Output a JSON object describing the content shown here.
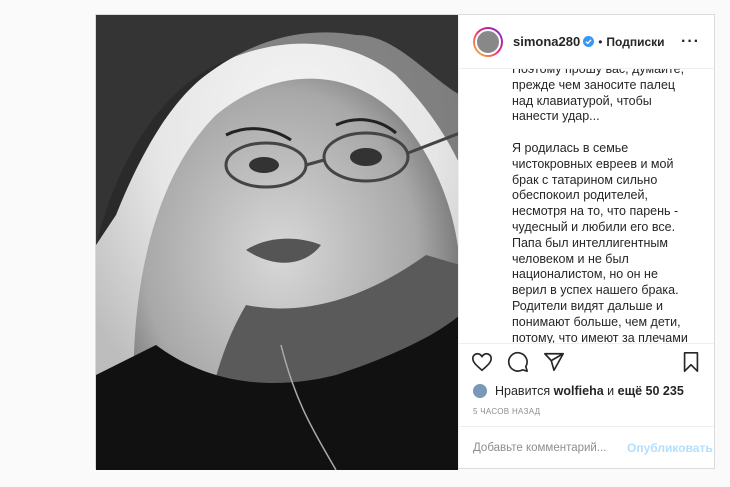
{
  "header": {
    "username": "simona280",
    "separator": "•",
    "follow_label": "Подписки",
    "more_icon": "more-horizontal-icon"
  },
  "caption": {
    "text": "Поэтому прошу вас, думайте, прежде чем заносите палец над клавиатурой, чтобы нанести удар...\n\nЯ родилась в семье чистокровных евреев и мой брак с татарином сильно обеспокоил родителей, несмотря на то, что парень - чудесный и любили его все. Папа был интеллигентным человеком и не был националистом, но он не верил в успех нашего брака. Родители видят дальше и понимают больше, чем дети, потому, что имеют за плечами некий опыт и прожитую жизнь...\nОказалось, что в нашей семье уже случалась такая история от которой родился мой (троюродный дядя? 🤔)- Тимур, в которого я была влюблена всё детство. Теперь вы понимаете почему я всю жизнь это"
  },
  "actions": {
    "like_icon": "heart-icon",
    "comment_icon": "comment-icon",
    "share_icon": "share-icon",
    "save_icon": "bookmark-icon"
  },
  "likes": {
    "prefix": "Нравится",
    "user": "wolfieha",
    "middle": "и",
    "others": "ещё 50 235"
  },
  "timestamp": "5 ЧАСОВ НАЗАД",
  "comment": {
    "placeholder": "Добавьте комментарий...",
    "publish_label": "Опубликовать"
  },
  "colors": {
    "accent": "#0095f6",
    "publish_disabled": "#b2dffc",
    "verified": "#3897f0"
  }
}
